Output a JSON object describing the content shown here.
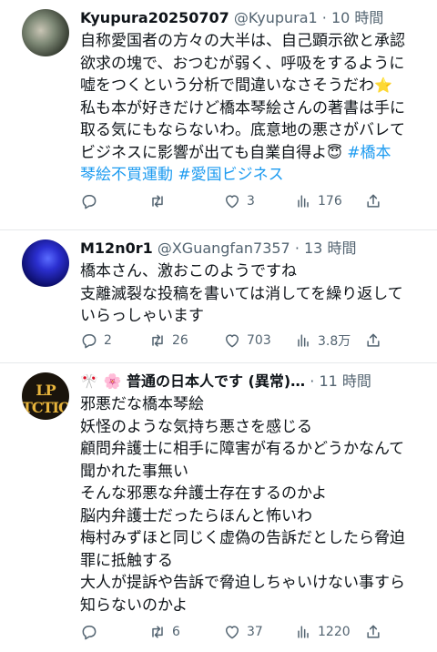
{
  "posts": [
    {
      "name": "Kyupura20250707",
      "handle": "@Kyupura1",
      "time": "· 10 時間",
      "lines": [
        "自称愛国者の方々の大半は、自己顕示欲と承認",
        "欲求の塊で、おつむが弱く、呼吸をするように",
        "嘘をつくという分析で間違いなさそうだわ",
        "私も本が好きだけど橋本琴絵さんの著書は手に",
        "取る気にもならないわ。底意地の悪さがバレて",
        "ビジネスに影響が出ても自業自得よ",
        "琴絵不買運動"
      ],
      "tags": [
        "#橋本",
        "#愛国ビジネス"
      ],
      "emoji_star": "⭐",
      "emoji_halo": "😇",
      "replies": "",
      "reposts": "",
      "likes": "3",
      "views": "176"
    },
    {
      "name": "M12n0r1",
      "handle": "@XGuangfan7357",
      "time": "· 13 時間",
      "lines": [
        "橋本さん、激おこのようですね",
        "支離滅裂な投稿を書いては消してを繰り返して",
        "いらっしゃいます"
      ],
      "replies": "2",
      "reposts": "26",
      "likes": "703",
      "views": "3.8万"
    },
    {
      "name": "🎌 🌸 普通の日本人です (異常)…",
      "handle": "",
      "time": "· 11 時間",
      "lines": [
        "邪悪だな橋本琴絵",
        "妖怪のような気持ち悪さを感じる",
        "顧問弁護士に相手に障害が有るかどうかなんて",
        "聞かれた事無い",
        "そんな邪悪な弁護士存在するのかよ",
        "脳内弁護士だったらほんと怖いわ",
        "梅村みずほと同じく虚偽の告訴だとしたら脅迫",
        "罪に抵触する",
        "大人が提訴や告訴で脅迫しちゃいけない事すら",
        "知らないのかよ"
      ],
      "replies": "",
      "reposts": "6",
      "likes": "37",
      "views": "1220"
    }
  ],
  "avatar3_logo": "LP TCTIO",
  "colors": {
    "text": "#0f1419",
    "muted": "#536471",
    "link": "#1d9bf0",
    "divider": "#e6e9eb"
  }
}
